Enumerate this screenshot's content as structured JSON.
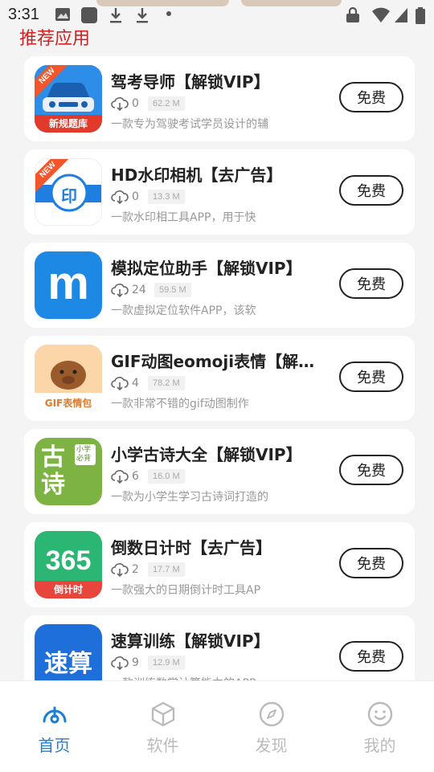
{
  "status_bar": {
    "time": "3:31"
  },
  "section_title": "推荐应用",
  "apps": [
    {
      "name": "驾考导师【解锁VIP】",
      "downloads": "0",
      "size": "62.2 M",
      "desc": "一款专为驾驶考试学员设计的辅",
      "button": "免费",
      "icon_text": "新规题库",
      "badge": "NEW"
    },
    {
      "name": "HD水印相机【去广告】",
      "downloads": "0",
      "size": "13.3 M",
      "desc": "一款水印相工具APP，用于快",
      "button": "免费",
      "icon_text": "印",
      "badge": "NEW"
    },
    {
      "name": "模拟定位助手【解锁VIP】",
      "downloads": "24",
      "size": "59.5 M",
      "desc": "一款虚拟定位软件APP，该软",
      "button": "免费",
      "icon_text": "m"
    },
    {
      "name": "GIF动图eomoji表情【解锁VIP】",
      "downloads": "4",
      "size": "78.2 M",
      "desc": "一款非常不错的gif动图制作",
      "button": "免费",
      "icon_text": "GIF表情包"
    },
    {
      "name": "小学古诗大全【解锁VIP】",
      "downloads": "6",
      "size": "16.0 M",
      "desc": "一款为小学生学习古诗词打造的",
      "button": "免费",
      "icon_text": "古诗",
      "icon_subtext": "小学必背"
    },
    {
      "name": "倒数日计时【去广告】",
      "downloads": "2",
      "size": "17.7 M",
      "desc": "一款强大的日期倒计时工具AP",
      "button": "免费",
      "icon_text": "365",
      "icon_subtext": "倒计时"
    },
    {
      "name": "速算训练【解锁VIP】",
      "downloads": "9",
      "size": "12.9 M",
      "desc": "一款训练数学计算能力的APP",
      "button": "免费",
      "icon_text": "速算"
    }
  ],
  "bottom_nav": [
    {
      "label": "首页",
      "icon": "home-icon",
      "active": true
    },
    {
      "label": "软件",
      "icon": "cube-icon",
      "active": false
    },
    {
      "label": "发现",
      "icon": "compass-icon",
      "active": false
    },
    {
      "label": "我的",
      "icon": "smile-icon",
      "active": false
    }
  ],
  "colors": {
    "accent": "#1c7fd6",
    "title_red": "#d32020",
    "inactive": "#bbbbbb"
  }
}
